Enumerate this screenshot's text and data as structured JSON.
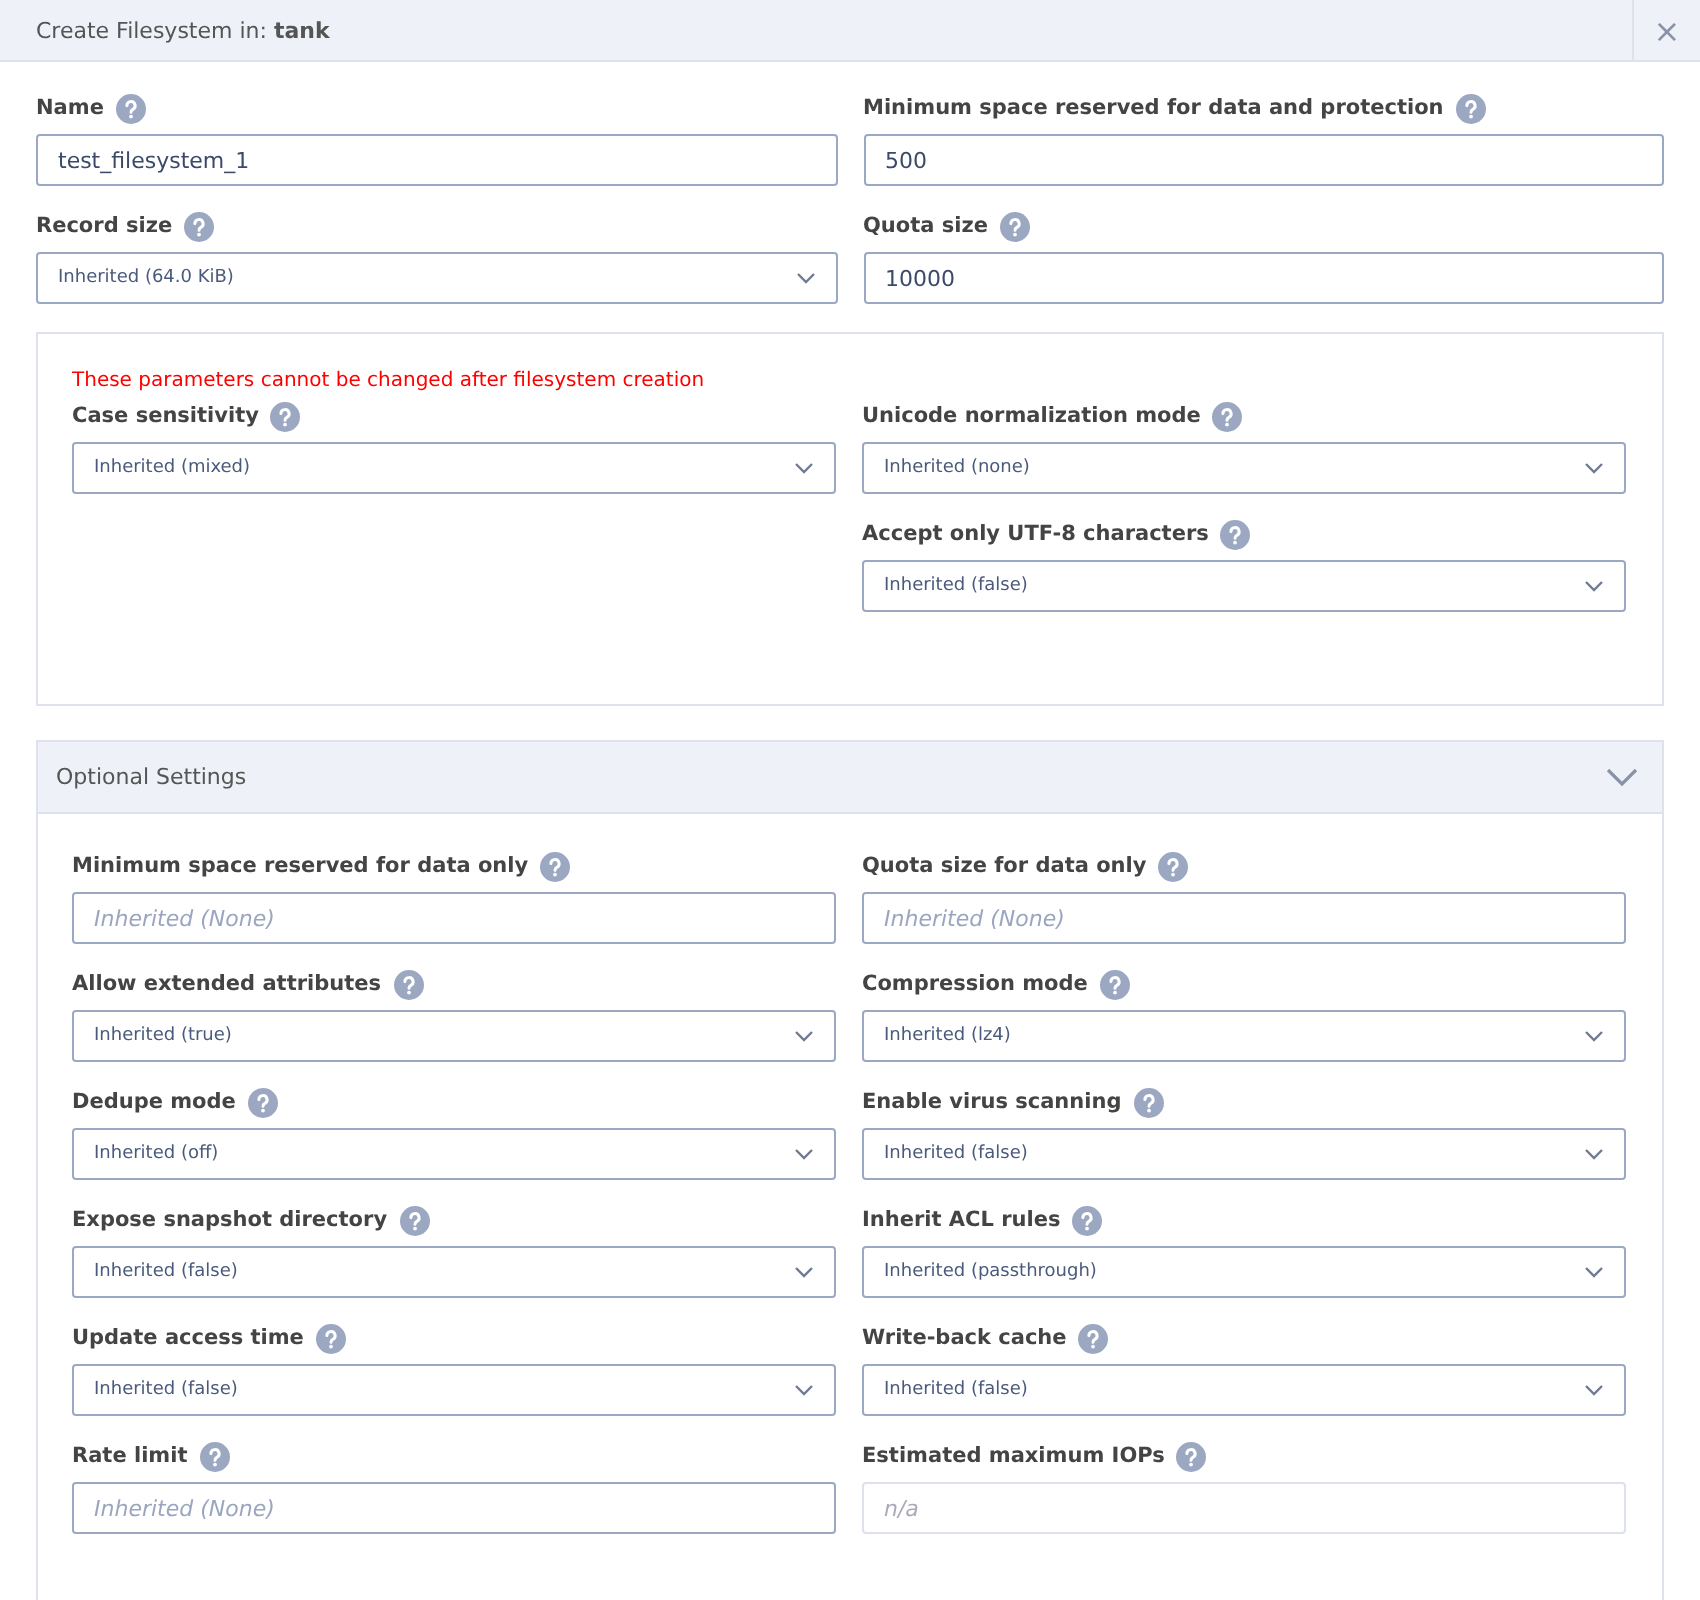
{
  "dialog": {
    "title_prefix": "Create Filesystem in:",
    "title_pool": "tank",
    "close": "×"
  },
  "fields": [
    {
      "label": "Name",
      "kind": "input",
      "value": "test_filesystem_1"
    },
    {
      "label": "Minimum space reserved for data and protection",
      "kind": "input",
      "value": "500"
    },
    {
      "label": "Record size",
      "kind": "select",
      "value": "Inherited (64.0 KiB)"
    },
    {
      "label": "Quota size",
      "kind": "input",
      "value": "10000"
    }
  ],
  "fixed_section": {
    "warning": "These parameters cannot be changed after filesystem creation",
    "left_fields": [
      {
        "label": "Case sensitivity",
        "kind": "select",
        "value": "Inherited (mixed)"
      }
    ],
    "right_fields": [
      {
        "label": "Unicode normalization mode",
        "kind": "select",
        "value": "Inherited (none)"
      },
      {
        "label": "Accept only UTF-8 characters",
        "kind": "select",
        "value": "Inherited (false)"
      }
    ]
  },
  "optional_settings": {
    "title": "Optional Settings",
    "expanded": true,
    "fields": [
      {
        "label": "Minimum space reserved for data only",
        "kind": "input",
        "placeholder": "Inherited (None)"
      },
      {
        "label": "Quota size for data only",
        "kind": "input",
        "placeholder": "Inherited (None)"
      },
      {
        "label": "Allow extended attributes",
        "kind": "select",
        "value": "Inherited (true)"
      },
      {
        "label": "Compression mode",
        "kind": "select",
        "value": "Inherited (lz4)"
      },
      {
        "label": "Dedupe mode",
        "kind": "select",
        "value": "Inherited (off)"
      },
      {
        "label": "Enable virus scanning",
        "kind": "select",
        "value": "Inherited (false)"
      },
      {
        "label": "Expose snapshot directory",
        "kind": "select",
        "value": "Inherited (false)"
      },
      {
        "label": "Inherit ACL rules",
        "kind": "select",
        "value": "Inherited (passthrough)"
      },
      {
        "label": "Update access time",
        "kind": "select",
        "value": "Inherited (false)"
      },
      {
        "label": "Write-back cache",
        "kind": "select",
        "value": "Inherited (false)"
      },
      {
        "label": "Rate limit",
        "kind": "input",
        "placeholder": "Inherited (None)"
      },
      {
        "label": "Estimated maximum IOPs",
        "kind": "input",
        "placeholder": "n/a",
        "disabled": true
      }
    ]
  }
}
